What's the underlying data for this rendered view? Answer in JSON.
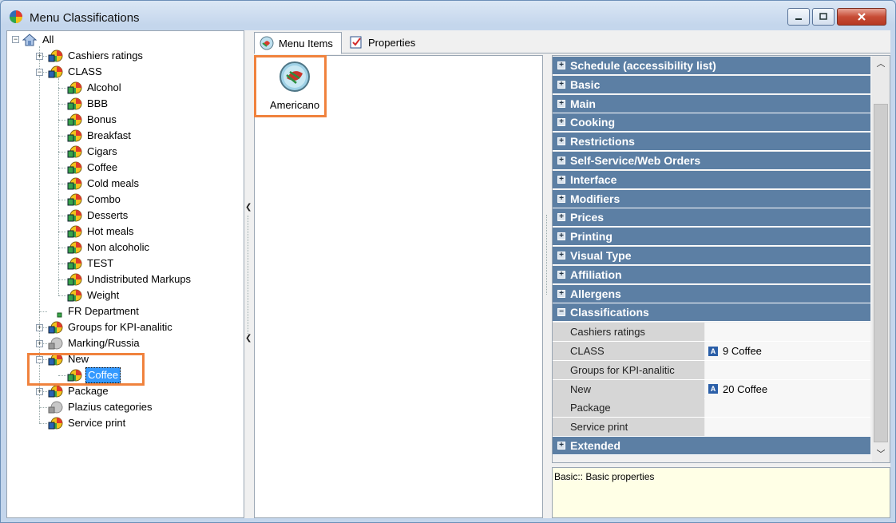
{
  "window": {
    "title": "Menu Classifications"
  },
  "tree": {
    "root": "All",
    "items": [
      {
        "label": "Cashiers ratings"
      },
      {
        "label": "CLASS"
      },
      {
        "label": "Alcohol"
      },
      {
        "label": "BBB"
      },
      {
        "label": "Bonus"
      },
      {
        "label": "Breakfast"
      },
      {
        "label": "Cigars"
      },
      {
        "label": "Coffee"
      },
      {
        "label": "Cold meals"
      },
      {
        "label": "Combo"
      },
      {
        "label": "Desserts"
      },
      {
        "label": "Hot meals"
      },
      {
        "label": "Non alcoholic"
      },
      {
        "label": "TEST"
      },
      {
        "label": "Undistributed Markups"
      },
      {
        "label": "Weight"
      },
      {
        "label": "FR Department"
      },
      {
        "label": "Groups for KPI-analitic"
      },
      {
        "label": "Marking/Russia"
      },
      {
        "label": "New"
      },
      {
        "label": "Coffee"
      },
      {
        "label": "Package"
      },
      {
        "label": "Plazius categories"
      },
      {
        "label": "Service print"
      }
    ]
  },
  "tabs": [
    {
      "label": "Menu Items"
    },
    {
      "label": "Properties"
    }
  ],
  "menu_items": [
    {
      "label": "Americano"
    }
  ],
  "property_categories": [
    "Schedule (accessibility list)",
    "Basic",
    "Main",
    "Cooking",
    "Restrictions",
    "Self-Service/Web Orders",
    "Interface",
    "Modifiers",
    "Prices",
    "Printing",
    "Visual Type",
    "Affiliation",
    "Allergens",
    "Classifications"
  ],
  "classification_rows": [
    {
      "name": "Cashiers ratings",
      "value": ""
    },
    {
      "name": "CLASS",
      "value": "9 Coffee"
    },
    {
      "name": "Groups for KPI-analitic",
      "value": ""
    },
    {
      "name": "New",
      "value": "20 Coffee"
    },
    {
      "name": "Package",
      "value": ""
    },
    {
      "name": "Service print",
      "value": ""
    }
  ],
  "extended_category": "Extended",
  "value_badge": "A",
  "description": "Basic:: Basic properties",
  "colors": {
    "accent_highlight": "#f0823d",
    "category_bg": "#5c7fa4",
    "selection": "#3399ff"
  }
}
